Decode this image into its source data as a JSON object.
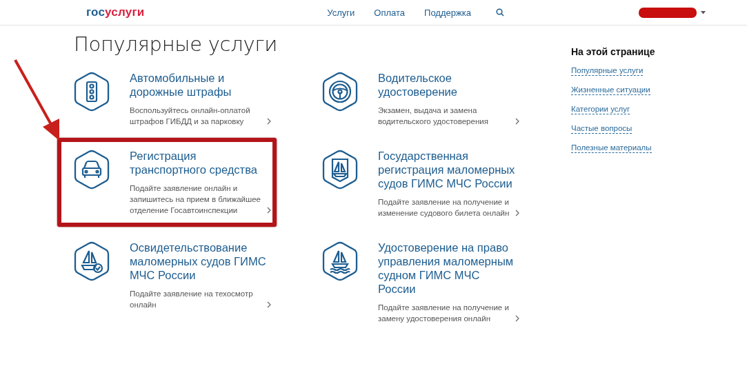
{
  "header": {
    "logo": {
      "part_1": "гос",
      "part_2": "услуги"
    },
    "nav": [
      "Услуги",
      "Оплата",
      "Поддержка"
    ]
  },
  "title": "Популярные услуги",
  "services": [
    {
      "kind": "traffic-light",
      "title": "Автомобильные и дорожные штрафы",
      "description": "Воспользуйтесь онлайн-оплатой штрафов ГИБДД и за парковку",
      "highlighted": false
    },
    {
      "kind": "steering-wheel",
      "title": "Водительское удостоверение",
      "description": "Экзамен, выдача и замена водительского удостоверения",
      "highlighted": false
    },
    {
      "kind": "car",
      "title": "Регистрация транспортного средства",
      "description": "Подайте заявление онлайн и запишитесь на прием в ближайшее отделение Госавтоинспекции",
      "highlighted": true
    },
    {
      "kind": "boat-document",
      "title": "Государственная регистрация маломерных судов ГИМС МЧС России",
      "description": "Подайте заявление на получение и изменение судового билета онлайн",
      "highlighted": false
    },
    {
      "kind": "boat-check",
      "title": "Освидетельствование маломерных судов ГИМС МЧС России",
      "description": "Подайте заявление на техосмотр онлайн",
      "highlighted": false
    },
    {
      "kind": "boat-waves",
      "title": "Удостоверение на право управления маломерным судном ГИМС МЧС России",
      "description": "Подайте заявление на получение и замену удостоверения онлайн",
      "highlighted": false
    }
  ],
  "sidebar": {
    "heading": "На этой странице",
    "links": [
      "Популярные услуги",
      "Жизненные ситуации",
      "Категории услуг",
      "Частые вопросы",
      "Полезные материалы"
    ]
  }
}
